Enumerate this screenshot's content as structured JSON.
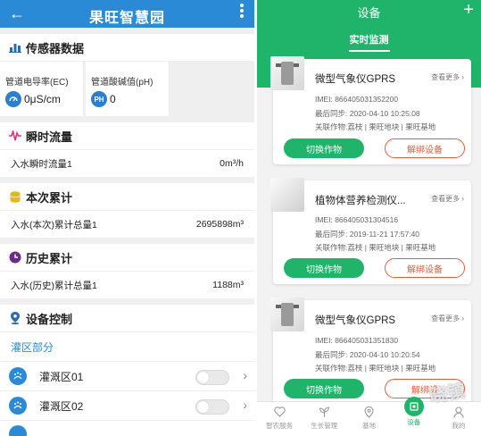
{
  "left": {
    "header": {
      "title": "果旺智慧园"
    },
    "sensor_section": {
      "title": "传感器数据"
    },
    "sensors": [
      {
        "name": "管道电导率(EC)",
        "icon": "speed-icon",
        "value": "0μS/cm"
      },
      {
        "name": "管道酸碱值(pH)",
        "icon_text": "PH",
        "value": "0"
      }
    ],
    "flow_section": {
      "title": "瞬时流量"
    },
    "flow_row": {
      "label": "入水瞬时流量1",
      "value": "0m³/h"
    },
    "current_section": {
      "title": "本次累计"
    },
    "current_row": {
      "label": "入水(本次)累计总量1",
      "value": "2695898m³"
    },
    "history_section": {
      "title": "历史累计"
    },
    "history_row": {
      "label": "入水(历史)累计总量1",
      "value": "1188m³"
    },
    "control_section": {
      "title": "设备控制"
    },
    "zone_group": {
      "label": "灌区部分"
    },
    "zones": [
      {
        "name": "灌溉区01"
      },
      {
        "name": "灌溉区02"
      }
    ],
    "colors": {
      "header": "#2b8ad6",
      "accent": "#2b8ad6"
    }
  },
  "right": {
    "header": {
      "title": "设备",
      "plus": "+"
    },
    "tab": {
      "label": "实时监测"
    },
    "devices": [
      {
        "name": "微型气象仪GPRS",
        "view_more": "查看更多",
        "imei": "IMEI: 866405031352200",
        "sync": "最后同步: 2020-04-10 10:25:08",
        "crop": "关联作物:荔枝 | 果旺地块 | 果旺基地",
        "btn_switch": "切换作物",
        "btn_unbind": "解绑设备"
      },
      {
        "name": "植物体营养检测仪...",
        "view_more": "查看更多",
        "imei": "IMEI: 866405031304516",
        "sync": "最后同步: 2019-11-21 17:57:40",
        "crop": "关联作物:荔枝 | 果旺地块 | 果旺基地",
        "btn_switch": "切换作物",
        "btn_unbind": "解绑设备"
      },
      {
        "name": "微型气象仪GPRS",
        "view_more": "查看更多",
        "imei": "IMEI: 866405031351830",
        "sync": "最后同步: 2020-04-10 10:20:54",
        "crop": "关联作物:荔枝 | 果旺地块 | 果旺基地",
        "btn_switch": "切换作物",
        "btn_unbind": "解绑设"
      }
    ],
    "bottom_nav": [
      {
        "label": "智农服务",
        "icon": "heart-icon"
      },
      {
        "label": "生长管理",
        "icon": "plant-icon"
      },
      {
        "label": "基地",
        "icon": "location-icon"
      },
      {
        "label": "设备",
        "icon": "device-icon",
        "active": true
      },
      {
        "label": "我的",
        "icon": "user-icon"
      }
    ],
    "watermark": "晓镇",
    "colors": {
      "primary": "#20b46a",
      "danger": "#e85b3a"
    }
  }
}
